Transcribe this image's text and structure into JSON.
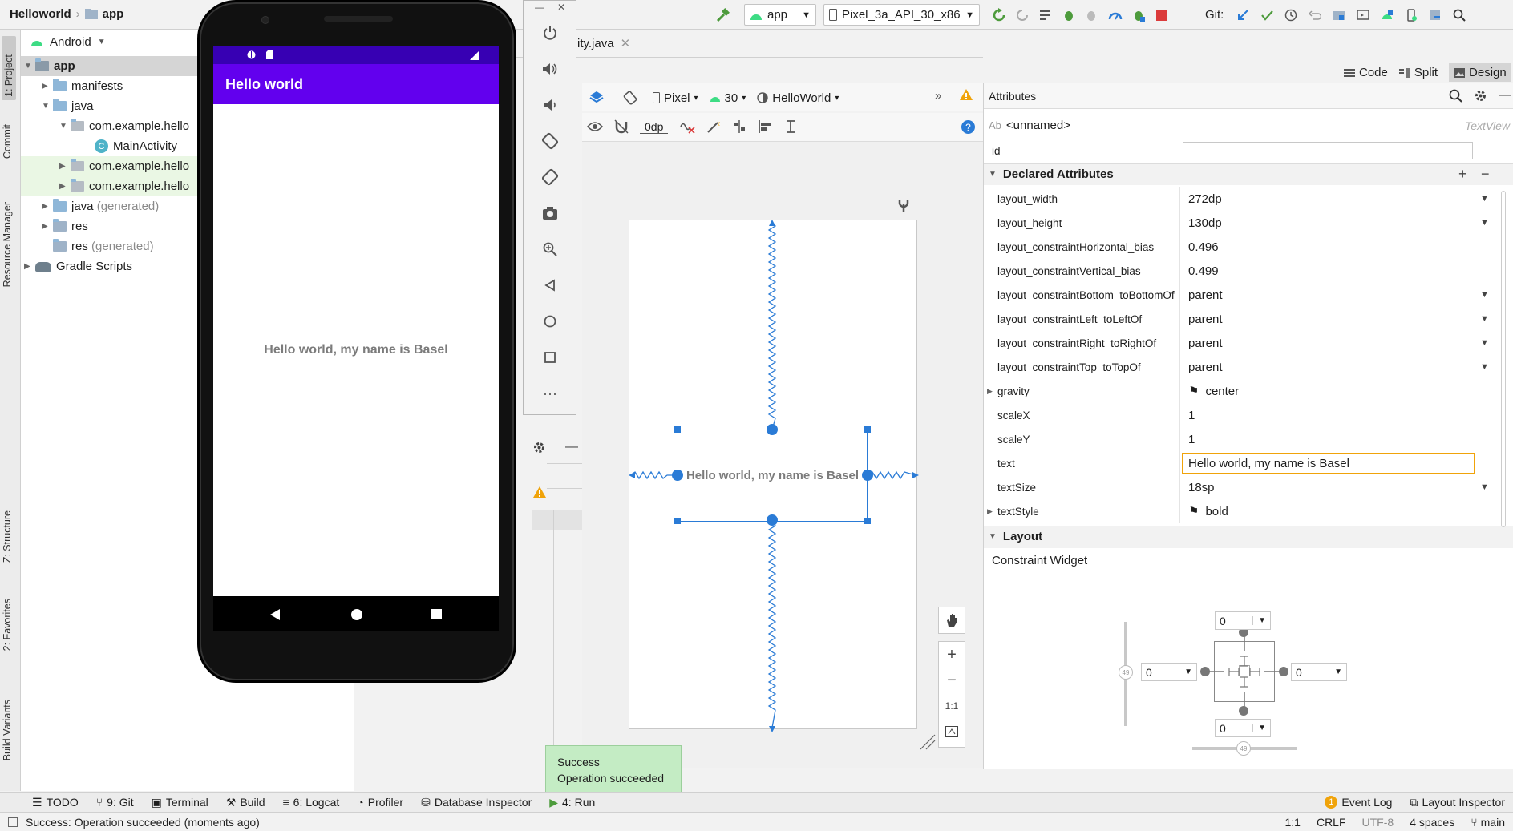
{
  "breadcrumb": {
    "project": "Helloworld",
    "module": "app"
  },
  "toolbar": {
    "run_config": "app",
    "device": "Pixel_3a_API_30_x86",
    "git_label": "Git:"
  },
  "left_stripe": {
    "tabs": [
      "1: Project",
      "Commit",
      "Resource Manager",
      "Z: Structure",
      "2: Favorites",
      "Build Variants"
    ]
  },
  "project_pane": {
    "view_mode": "Android",
    "tree": [
      {
        "label": "app",
        "bold": true
      },
      {
        "label": "manifests"
      },
      {
        "label": "java"
      },
      {
        "label": "com.example.hello"
      },
      {
        "label": "MainActivity"
      },
      {
        "label": "com.example.hello"
      },
      {
        "label": "com.example.hello"
      },
      {
        "label": "java",
        "suffix": "(generated)"
      },
      {
        "label": "res"
      },
      {
        "label": "res",
        "suffix": "(generated)"
      },
      {
        "label": "Gradle Scripts"
      }
    ]
  },
  "editor": {
    "tab_label": "ity.java",
    "view_modes": [
      "Code",
      "Split",
      "Design"
    ],
    "design_bar": {
      "device": "Pixel",
      "api": "30",
      "theme": "HelloWorld",
      "margin": "0dp"
    },
    "preview_text": "Hello world, my name is Basel",
    "zoom_label": "1:1"
  },
  "phone": {
    "app_title": "Hello world",
    "body_text": "Hello world, my name is Basel"
  },
  "attributes": {
    "header": "Attributes",
    "component": "<unnamed>",
    "component_type": "TextView",
    "id_label": "id",
    "id_value": "",
    "declared_section": "Declared Attributes",
    "declared": [
      {
        "name": "layout_width",
        "value": "272dp",
        "dropdown": true
      },
      {
        "name": "layout_height",
        "value": "130dp",
        "dropdown": true
      },
      {
        "name": "layout_constraintHorizontal_bias",
        "value": "0.496"
      },
      {
        "name": "layout_constraintVertical_bias",
        "value": "0.499"
      },
      {
        "name": "layout_constraintBottom_toBottomOf",
        "value": "parent",
        "dropdown": true
      },
      {
        "name": "layout_constraintLeft_toLeftOf",
        "value": "parent",
        "dropdown": true
      },
      {
        "name": "layout_constraintRight_toRightOf",
        "value": "parent",
        "dropdown": true
      },
      {
        "name": "layout_constraintTop_toTopOf",
        "value": "parent",
        "dropdown": true
      },
      {
        "name": "gravity",
        "value": "center",
        "flag": true
      },
      {
        "name": "scaleX",
        "value": "1"
      },
      {
        "name": "scaleY",
        "value": "1"
      },
      {
        "name": "text",
        "value": "Hello world, my name is Basel",
        "focused": true
      },
      {
        "name": "textSize",
        "value": "18sp",
        "dropdown": true
      },
      {
        "name": "textStyle",
        "value": "bold",
        "flag": true
      }
    ],
    "layout_section": "Layout",
    "constraint_label": "Constraint Widget",
    "margins": {
      "top": "0",
      "left": "0",
      "right": "0",
      "bottom": "0"
    },
    "bias_label": "49"
  },
  "bottom_tabs": [
    "TODO",
    "9: Git",
    "Terminal",
    "Build",
    "6: Logcat",
    "Profiler",
    "Database Inspector",
    "4: Run"
  ],
  "bottom_right_tabs": [
    "Event Log",
    "Layout Inspector"
  ],
  "event_count": "1",
  "toast": {
    "title": "Success",
    "message": "Operation succeeded"
  },
  "status": {
    "message": "Success: Operation succeeded (moments ago)",
    "position": "1:1",
    "line_sep": "CRLF",
    "encoding": "UTF-8",
    "indent": "4 spaces",
    "branch": "main"
  }
}
